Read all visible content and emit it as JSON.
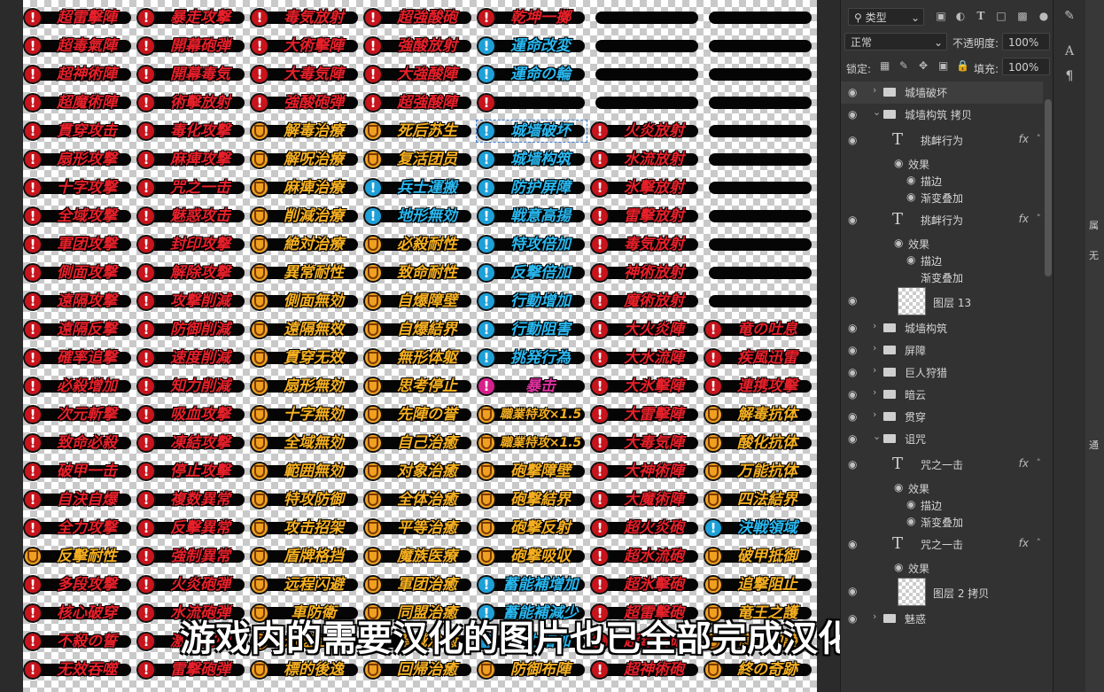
{
  "colors": {
    "red": "#e8202a",
    "orange": "#f6b020",
    "blue": "#28b8f0",
    "magenta": "#e030a0"
  },
  "grid": {
    "columns": [
      [
        {
          "t": "超雷擊陣",
          "c": "red"
        },
        {
          "t": "超毒氣陣",
          "c": "red"
        },
        {
          "t": "超神術陣",
          "c": "red"
        },
        {
          "t": "超魔術陣",
          "c": "red"
        },
        {
          "t": "貫穿攻击",
          "c": "red"
        },
        {
          "t": "扇形攻撃",
          "c": "red"
        },
        {
          "t": "十字攻撃",
          "c": "red"
        },
        {
          "t": "全域攻撃",
          "c": "red"
        },
        {
          "t": "軍团攻撃",
          "c": "red"
        },
        {
          "t": "側面攻撃",
          "c": "red"
        },
        {
          "t": "遠隔攻撃",
          "c": "red"
        },
        {
          "t": "遠隔反撃",
          "c": "red"
        },
        {
          "t": "確率追撃",
          "c": "red"
        },
        {
          "t": "必殺增加",
          "c": "red"
        },
        {
          "t": "次元斬撃",
          "c": "red"
        },
        {
          "t": "致命必殺",
          "c": "red"
        },
        {
          "t": "破甲一击",
          "c": "red"
        },
        {
          "t": "自決自爆",
          "c": "red"
        },
        {
          "t": "全力攻撃",
          "c": "red"
        },
        {
          "t": "反擊耐性",
          "c": "orange"
        },
        {
          "t": "多段攻撃",
          "c": "red"
        },
        {
          "t": "核心破穿",
          "c": "red"
        },
        {
          "t": "不殺の誓",
          "c": "red"
        },
        {
          "t": "无效吞噬",
          "c": "red"
        }
      ],
      [
        {
          "t": "暴走攻撃",
          "c": "red"
        },
        {
          "t": "開幕砲弾",
          "c": "red"
        },
        {
          "t": "開幕毒気",
          "c": "red"
        },
        {
          "t": "術擊放射",
          "c": "red"
        },
        {
          "t": "毒化攻撃",
          "c": "red"
        },
        {
          "t": "麻痺攻撃",
          "c": "red"
        },
        {
          "t": "咒之一击",
          "c": "red"
        },
        {
          "t": "魅惑攻击",
          "c": "red"
        },
        {
          "t": "封印攻撃",
          "c": "red"
        },
        {
          "t": "解除攻撃",
          "c": "red"
        },
        {
          "t": "攻撃削減",
          "c": "red"
        },
        {
          "t": "防御削減",
          "c": "red"
        },
        {
          "t": "速度削減",
          "c": "red"
        },
        {
          "t": "知力削減",
          "c": "red"
        },
        {
          "t": "吸血攻撃",
          "c": "red"
        },
        {
          "t": "凍結攻撃",
          "c": "red"
        },
        {
          "t": "停止攻擊",
          "c": "red"
        },
        {
          "t": "複数異常",
          "c": "red"
        },
        {
          "t": "反擊異常",
          "c": "red"
        },
        {
          "t": "強制異常",
          "c": "red"
        },
        {
          "t": "火炎砲弾",
          "c": "red"
        },
        {
          "t": "水流砲弾",
          "c": "red"
        },
        {
          "t": "激流砲弾",
          "c": "red"
        },
        {
          "t": "雷撃砲弾",
          "c": "red"
        }
      ],
      [
        {
          "t": "毒気放射",
          "c": "red"
        },
        {
          "t": "大術擊陣",
          "c": "red"
        },
        {
          "t": "大毒気陣",
          "c": "red"
        },
        {
          "t": "強酸砲弾",
          "c": "red"
        },
        {
          "t": "解毒治療",
          "c": "orange"
        },
        {
          "t": "解呪治療",
          "c": "orange"
        },
        {
          "t": "麻痺治療",
          "c": "orange"
        },
        {
          "t": "削減治療",
          "c": "orange"
        },
        {
          "t": "絶対治療",
          "c": "orange"
        },
        {
          "t": "異常耐性",
          "c": "orange"
        },
        {
          "t": "側面無効",
          "c": "orange"
        },
        {
          "t": "遠隔無效",
          "c": "orange"
        },
        {
          "t": "貫穿无效",
          "c": "orange"
        },
        {
          "t": "扇形無効",
          "c": "orange"
        },
        {
          "t": "十字無効",
          "c": "orange"
        },
        {
          "t": "全域無効",
          "c": "orange"
        },
        {
          "t": "範囲無効",
          "c": "orange"
        },
        {
          "t": "特攻防御",
          "c": "orange"
        },
        {
          "t": "攻击招架",
          "c": "orange"
        },
        {
          "t": "盾牌格挡",
          "c": "orange"
        },
        {
          "t": "远程闪避",
          "c": "orange"
        },
        {
          "t": "車防衛",
          "c": "orange"
        },
        {
          "t": "迅速治療",
          "c": "orange"
        },
        {
          "t": "標的後逸",
          "c": "orange"
        }
      ],
      [
        {
          "t": "超強酸砲",
          "c": "red"
        },
        {
          "t": "強酸放射",
          "c": "red"
        },
        {
          "t": "大強酸陣",
          "c": "red"
        },
        {
          "t": "超強酸陣",
          "c": "red"
        },
        {
          "t": "死后苏生",
          "c": "orange"
        },
        {
          "t": "复活团员",
          "c": "orange"
        },
        {
          "t": "兵士運搬",
          "c": "blue"
        },
        {
          "t": "地形無効",
          "c": "blue"
        },
        {
          "t": "必殺耐性",
          "c": "orange"
        },
        {
          "t": "致命耐性",
          "c": "orange"
        },
        {
          "t": "自爆障壁",
          "c": "orange"
        },
        {
          "t": "自爆結界",
          "c": "orange"
        },
        {
          "t": "無形体躯",
          "c": "orange"
        },
        {
          "t": "思考停止",
          "c": "orange"
        },
        {
          "t": "先陣の誉",
          "c": "orange"
        },
        {
          "t": "自己治癒",
          "c": "orange"
        },
        {
          "t": "对象治癒",
          "c": "orange"
        },
        {
          "t": "全体治癒",
          "c": "orange"
        },
        {
          "t": "平等治癒",
          "c": "orange"
        },
        {
          "t": "魔族医療",
          "c": "orange"
        },
        {
          "t": "軍团治癒",
          "c": "orange"
        },
        {
          "t": "同盟治癒",
          "c": "orange"
        },
        {
          "t": "聖域治癒",
          "c": "orange"
        },
        {
          "t": "回帰治癒",
          "c": "orange"
        }
      ],
      [
        {
          "t": "乾坤一擲",
          "c": "red"
        },
        {
          "t": "運命改変",
          "c": "blue"
        },
        {
          "t": "運命の輪",
          "c": "blue"
        },
        {
          "t": "",
          "c": "red"
        },
        {
          "t": "城墙破坏",
          "c": "blue",
          "sel": true
        },
        {
          "t": "城墙构筑",
          "c": "blue"
        },
        {
          "t": "防护屏障",
          "c": "blue"
        },
        {
          "t": "戦意高揚",
          "c": "blue"
        },
        {
          "t": "特攻倍加",
          "c": "blue"
        },
        {
          "t": "反撃倍加",
          "c": "blue"
        },
        {
          "t": "行動增加",
          "c": "blue"
        },
        {
          "t": "行動阻害",
          "c": "blue"
        },
        {
          "t": "挑発行為",
          "c": "blue"
        },
        {
          "t": "暴击",
          "c": "magenta"
        },
        {
          "t": "職業特攻×1.5",
          "c": "orange"
        },
        {
          "t": "職業特攻×1.5",
          "c": "orange"
        },
        {
          "t": "砲撃障壁",
          "c": "orange"
        },
        {
          "t": "砲撃結界",
          "c": "orange"
        },
        {
          "t": "砲撃反射",
          "c": "orange"
        },
        {
          "t": "砲撃吸収",
          "c": "orange"
        },
        {
          "t": "蓄能補增加",
          "c": "blue"
        },
        {
          "t": "蓄能補減少",
          "c": "blue"
        },
        {
          "t": "能力增加",
          "c": "blue"
        },
        {
          "t": "防御布陣",
          "c": "orange"
        }
      ],
      [
        {
          "t": "",
          "c": "red",
          "empty": true
        },
        {
          "t": "",
          "c": "red",
          "empty": true
        },
        {
          "t": "",
          "c": "red",
          "empty": true
        },
        {
          "t": "",
          "c": "red",
          "empty": true
        },
        {
          "t": "火炎放射",
          "c": "red"
        },
        {
          "t": "水流放射",
          "c": "red"
        },
        {
          "t": "氷擊放射",
          "c": "red"
        },
        {
          "t": "雷擊放射",
          "c": "red"
        },
        {
          "t": "毒気放射",
          "c": "red"
        },
        {
          "t": "神術放射",
          "c": "red"
        },
        {
          "t": "魔術放射",
          "c": "red"
        },
        {
          "t": "大火炎陣",
          "c": "red"
        },
        {
          "t": "大水流陣",
          "c": "red"
        },
        {
          "t": "大氷擊陣",
          "c": "red"
        },
        {
          "t": "大雷擊陣",
          "c": "red"
        },
        {
          "t": "大毒気陣",
          "c": "red"
        },
        {
          "t": "大神術陣",
          "c": "red"
        },
        {
          "t": "大魔術陣",
          "c": "red"
        },
        {
          "t": "超火炎砲",
          "c": "red"
        },
        {
          "t": "超水流砲",
          "c": "red"
        },
        {
          "t": "超氷擊砲",
          "c": "red"
        },
        {
          "t": "超雷擊砲",
          "c": "red"
        },
        {
          "t": "超毒気砲",
          "c": "red"
        },
        {
          "t": "超神術砲",
          "c": "red"
        }
      ],
      [
        {
          "t": "",
          "c": "red",
          "empty": true
        },
        {
          "t": "",
          "c": "red",
          "empty": true
        },
        {
          "t": "",
          "c": "red",
          "empty": true
        },
        {
          "t": "",
          "c": "red",
          "empty": true
        },
        {
          "t": "",
          "c": "red",
          "empty": true
        },
        {
          "t": "",
          "c": "red",
          "empty": true
        },
        {
          "t": "",
          "c": "red",
          "empty": true
        },
        {
          "t": "",
          "c": "red",
          "empty": true
        },
        {
          "t": "",
          "c": "red",
          "empty": true
        },
        {
          "t": "",
          "c": "red",
          "empty": true
        },
        {
          "t": "",
          "c": "red",
          "empty": true
        },
        {
          "t": "竜の吐息",
          "c": "red"
        },
        {
          "t": "疾風迅雷",
          "c": "red"
        },
        {
          "t": "連携攻擊",
          "c": "red"
        },
        {
          "t": "解毒抗体",
          "c": "orange"
        },
        {
          "t": "酸化抗体",
          "c": "orange"
        },
        {
          "t": "万能抗体",
          "c": "orange"
        },
        {
          "t": "四法結界",
          "c": "orange"
        },
        {
          "t": "決戦領域",
          "c": "blue"
        },
        {
          "t": "破甲抵御",
          "c": "orange"
        },
        {
          "t": "追撃阻止",
          "c": "orange"
        },
        {
          "t": "竜王之護",
          "c": "orange"
        },
        {
          "t": "竜の加護",
          "c": "orange"
        },
        {
          "t": "終の奇跡",
          "c": "orange"
        }
      ]
    ]
  },
  "subtitle": "游戏内的需要汉化的图片也已全部完成汉化修图",
  "panel": {
    "filter_label": "类型",
    "blend_mode": "正常",
    "opacity_label": "不透明度:",
    "opacity_value": "100%",
    "lock_label": "锁定:",
    "fill_label": "填充:",
    "fill_value": "100%",
    "layers": [
      {
        "kind": "folder",
        "name": "城墙破坏",
        "indent": 0,
        "expanded": false,
        "selected": true
      },
      {
        "kind": "folder",
        "name": "城墙构筑 拷贝",
        "indent": 0,
        "expanded": true
      },
      {
        "kind": "text",
        "name": "挑衅行为",
        "indent": 1,
        "fx": true
      },
      {
        "kind": "sub",
        "name": "效果",
        "indent": 2,
        "eye": true
      },
      {
        "kind": "sub",
        "name": "描边",
        "indent": 3,
        "eye": true
      },
      {
        "kind": "sub",
        "name": "渐变叠加",
        "indent": 3,
        "eye": true
      },
      {
        "kind": "text",
        "name": "挑衅行为",
        "indent": 1,
        "fx": true
      },
      {
        "kind": "sub",
        "name": "效果",
        "indent": 2,
        "eye": true
      },
      {
        "kind": "sub",
        "name": "描边",
        "indent": 3,
        "eye": true
      },
      {
        "kind": "sub",
        "name": "渐变叠加",
        "indent": 3,
        "eye": false
      },
      {
        "kind": "image",
        "name": "图层 13",
        "indent": 1
      },
      {
        "kind": "folder",
        "name": "城墙构筑",
        "indent": 0,
        "expanded": false
      },
      {
        "kind": "folder",
        "name": "屏障",
        "indent": 0,
        "expanded": false
      },
      {
        "kind": "folder",
        "name": "巨人狩猎",
        "indent": 0,
        "expanded": false
      },
      {
        "kind": "folder",
        "name": "暗云",
        "indent": 0,
        "expanded": false
      },
      {
        "kind": "folder",
        "name": "贯穿",
        "indent": 0,
        "expanded": false
      },
      {
        "kind": "folder",
        "name": "诅咒",
        "indent": 0,
        "expanded": true
      },
      {
        "kind": "text",
        "name": "咒之一击",
        "indent": 1,
        "fx": true
      },
      {
        "kind": "sub",
        "name": "效果",
        "indent": 2,
        "eye": true
      },
      {
        "kind": "sub",
        "name": "描边",
        "indent": 3,
        "eye": true
      },
      {
        "kind": "sub",
        "name": "渐变叠加",
        "indent": 3,
        "eye": true
      },
      {
        "kind": "text",
        "name": "咒之一击",
        "indent": 1,
        "fx": true
      },
      {
        "kind": "sub",
        "name": "效果",
        "indent": 2,
        "eye": true
      },
      {
        "kind": "image",
        "name": "图层 2 拷贝",
        "indent": 1
      },
      {
        "kind": "folder",
        "name": "魅惑",
        "indent": 0,
        "expanded": false
      }
    ]
  },
  "rightstrip": {
    "labels": [
      "属",
      "无",
      "通"
    ]
  }
}
